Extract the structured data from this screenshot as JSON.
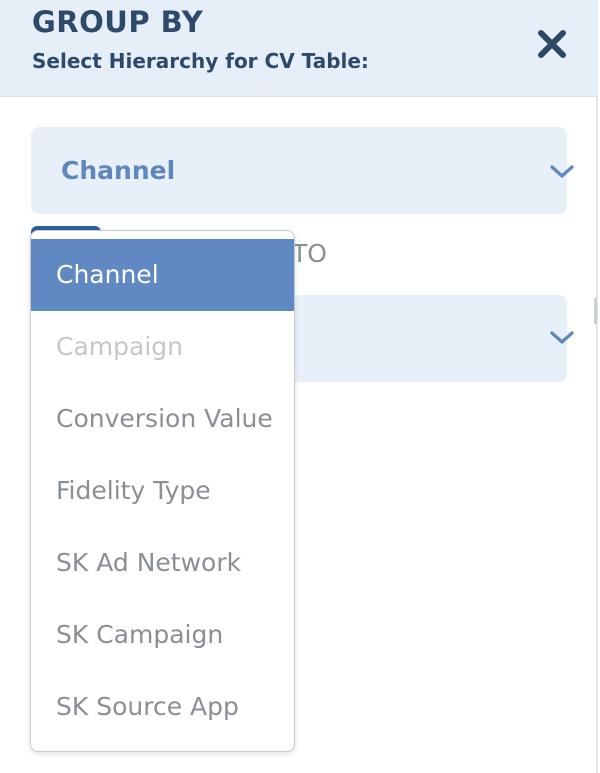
{
  "header": {
    "title": "GROUP BY",
    "subtitle": "Select Hierarchy for CV Table:",
    "close_icon": "close-icon"
  },
  "first_select": {
    "value": "Channel",
    "icon": "chevron-down-icon"
  },
  "second_select": {
    "value": "",
    "icon": "chevron-down-icon"
  },
  "behind_label": "TO",
  "dropdown": {
    "options": [
      {
        "label": "Channel",
        "state": "selected"
      },
      {
        "label": "Campaign",
        "state": "disabled"
      },
      {
        "label": "Conversion Value",
        "state": "normal"
      },
      {
        "label": "Fidelity Type",
        "state": "normal"
      },
      {
        "label": "SK Ad Network",
        "state": "normal"
      },
      {
        "label": "SK Campaign",
        "state": "normal"
      },
      {
        "label": "SK Source App",
        "state": "normal"
      }
    ]
  },
  "colors": {
    "header_bg": "#e6eef7",
    "header_text": "#2e4a6b",
    "select_bg": "#e7eff8",
    "select_text": "#5f87bd",
    "selected_option_bg": "#6089c4",
    "option_text": "#8a8f96",
    "disabled_option_text": "#c3c7cc"
  }
}
